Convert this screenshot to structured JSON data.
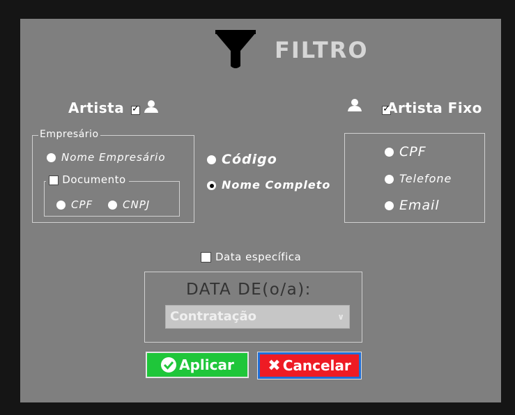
{
  "dialog": {
    "title": "FILTRO",
    "funnel_icon": "funnel-icon"
  },
  "artist": {
    "label": "Artista",
    "checked": true,
    "user_icon": "user-icon"
  },
  "artist_fixed": {
    "label": "Artista Fixo",
    "checked": true,
    "user_icon": "user-icon"
  },
  "empresario": {
    "legend": "Empresário",
    "option_name": "Nome Empresário",
    "documento": {
      "legend": "Documento",
      "checked": false,
      "options": [
        "CPF",
        "CNPJ"
      ]
    }
  },
  "center_options": {
    "codigo": "Código",
    "nome_completo": "Nome Completo",
    "selected": "Nome Completo"
  },
  "fixo_options": {
    "cpf": "CPF",
    "telefone": "Telefone",
    "email": "Email"
  },
  "date": {
    "specific_label": "Data específica",
    "specific_checked": false,
    "heading": "DATA DE(o/a):",
    "select_value": "Contratação"
  },
  "buttons": {
    "apply": "Aplicar",
    "cancel": "Cancelar"
  },
  "colors": {
    "dialog_bg": "#7f7f7f",
    "apply_bg": "#1fc63a",
    "cancel_bg": "#ee1b24",
    "cancel_border": "#1e6fd8"
  }
}
